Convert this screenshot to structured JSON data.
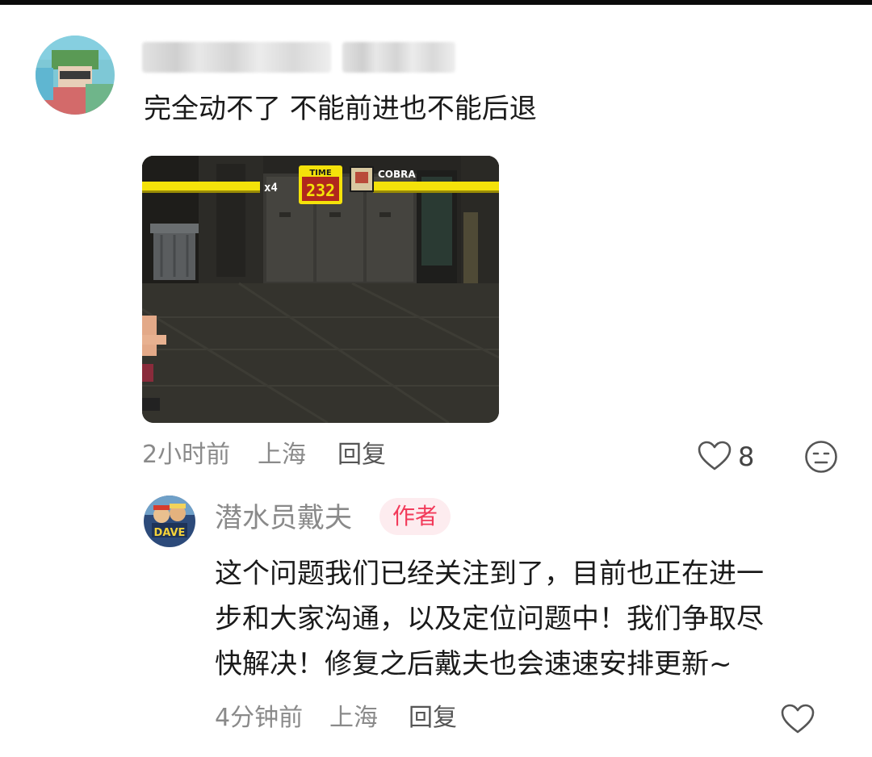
{
  "comment": {
    "text": "完全动不了 不能前进也不能后退",
    "time": "2小时前",
    "location": "上海",
    "reply_label": "回复",
    "like_count": "8",
    "image": {
      "hud_lives": "x4",
      "hud_time_label": "TIME",
      "hud_time_value": "232",
      "hud_enemy_name": "COBRA"
    }
  },
  "reply": {
    "author": "潜水员戴夫",
    "badge": "作者",
    "avatar_text": "DAVE",
    "text_lines": [
      "这个问题我们已经关注到了，目前也正在进一",
      "步和大家沟通，以及定位问题中！我们争取尽",
      "快解决！修复之后戴夫也会速速安排更新~"
    ],
    "time": "4分钟前",
    "location": "上海",
    "reply_label": "回复"
  },
  "colors": {
    "author_badge_bg": "#fdecef",
    "author_badge_text": "#f23a5a",
    "hud_yellow": "#f4e20a",
    "meta_gray": "#8a8a8a"
  }
}
